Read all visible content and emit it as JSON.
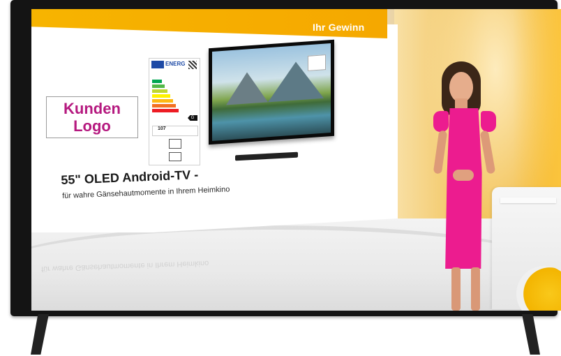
{
  "screen": {
    "banner_title": "Ihr Gewinn",
    "logo_placeholder": {
      "line1": "Kunden",
      "line2": "Logo"
    },
    "product": {
      "headline": "55\" OLED Android-TV -",
      "subline": "für wahre Gänsehautmomente in Ihrem Heimkino"
    },
    "energy_label": {
      "title": "ENERG",
      "rating": "G",
      "kwh": "107"
    }
  },
  "colors": {
    "accent_orange": "#f5a800",
    "logo_text_magenta": "#b5197f",
    "dress_pink": "#ec1c8f"
  }
}
